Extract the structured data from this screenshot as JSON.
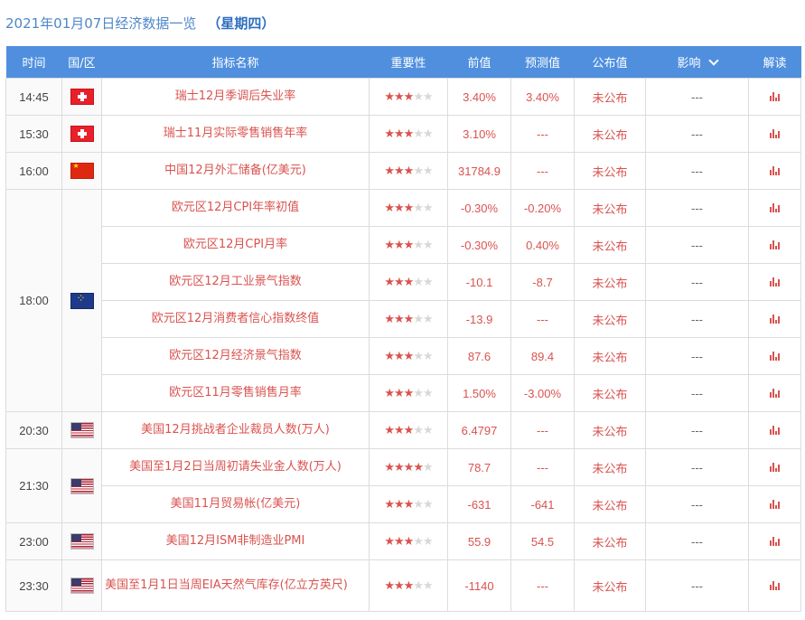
{
  "header": {
    "date_title": "2021年01月07日经济数据一览",
    "weekday": "（星期四）"
  },
  "columns": {
    "time": "时间",
    "country": "国/区",
    "indicator": "指标名称",
    "importance": "重要性",
    "previous": "前值",
    "forecast": "预测值",
    "actual": "公布值",
    "effect": "影响",
    "interpret": "解读"
  },
  "icons": {
    "effect_dropdown": "chevron-down-icon",
    "interpret": "bar-chart-icon",
    "importance": "star-icon"
  },
  "colors": {
    "header_bg": "#4f8fde",
    "accent_red": "#d9534f",
    "title_blue": "#4d87c9"
  },
  "groups": [
    {
      "time": "14:45",
      "flag": "switzerland-flag",
      "rows": [
        {
          "name": "瑞士12月季调后失业率",
          "stars": 3,
          "previous": "3.40%",
          "forecast": "3.40%",
          "actual": "未公布",
          "effect": "---"
        }
      ]
    },
    {
      "time": "15:30",
      "flag": "switzerland-flag",
      "rows": [
        {
          "name": "瑞士11月实际零售销售年率",
          "stars": 3,
          "previous": "3.10%",
          "forecast": "---",
          "actual": "未公布",
          "effect": "---"
        }
      ]
    },
    {
      "time": "16:00",
      "flag": "china-flag",
      "rows": [
        {
          "name": "中国12月外汇储备(亿美元)",
          "stars": 3,
          "previous": "31784.9",
          "forecast": "---",
          "actual": "未公布",
          "effect": "---"
        }
      ]
    },
    {
      "time": "18:00",
      "flag": "eurozone-flag",
      "rows": [
        {
          "name": "欧元区12月CPI年率初值",
          "stars": 3,
          "previous": "-0.30%",
          "forecast": "-0.20%",
          "actual": "未公布",
          "effect": "---"
        },
        {
          "name": "欧元区12月CPI月率",
          "stars": 3,
          "previous": "-0.30%",
          "forecast": "0.40%",
          "actual": "未公布",
          "effect": "---"
        },
        {
          "name": "欧元区12月工业景气指数",
          "stars": 3,
          "previous": "-10.1",
          "forecast": "-8.7",
          "actual": "未公布",
          "effect": "---"
        },
        {
          "name": "欧元区12月消费者信心指数终值",
          "stars": 3,
          "previous": "-13.9",
          "forecast": "---",
          "actual": "未公布",
          "effect": "---"
        },
        {
          "name": "欧元区12月经济景气指数",
          "stars": 3,
          "previous": "87.6",
          "forecast": "89.4",
          "actual": "未公布",
          "effect": "---"
        },
        {
          "name": "欧元区11月零售销售月率",
          "stars": 3,
          "previous": "1.50%",
          "forecast": "-3.00%",
          "actual": "未公布",
          "effect": "---"
        }
      ]
    },
    {
      "time": "20:30",
      "flag": "usa-flag",
      "rows": [
        {
          "name": "美国12月挑战者企业裁员人数(万人)",
          "stars": 3,
          "previous": "6.4797",
          "forecast": "---",
          "actual": "未公布",
          "effect": "---"
        }
      ]
    },
    {
      "time": "21:30",
      "flag": "usa-flag",
      "rows": [
        {
          "name": "美国至1月2日当周初请失业金人数(万人)",
          "stars": 4,
          "previous": "78.7",
          "forecast": "---",
          "actual": "未公布",
          "effect": "---"
        },
        {
          "name": "美国11月贸易帐(亿美元)",
          "stars": 3,
          "previous": "-631",
          "forecast": "-641",
          "actual": "未公布",
          "effect": "---"
        }
      ]
    },
    {
      "time": "23:00",
      "flag": "usa-flag",
      "rows": [
        {
          "name": "美国12月ISM非制造业PMI",
          "stars": 3,
          "previous": "55.9",
          "forecast": "54.5",
          "actual": "未公布",
          "effect": "---"
        }
      ]
    },
    {
      "time": "23:30",
      "flag": "usa-flag",
      "rows": [
        {
          "name": "美国至1月1日当周EIA天然气库存(亿立方英尺)",
          "stars": 3,
          "previous": "-1140",
          "forecast": "---",
          "actual": "未公布",
          "effect": "---"
        }
      ]
    }
  ]
}
